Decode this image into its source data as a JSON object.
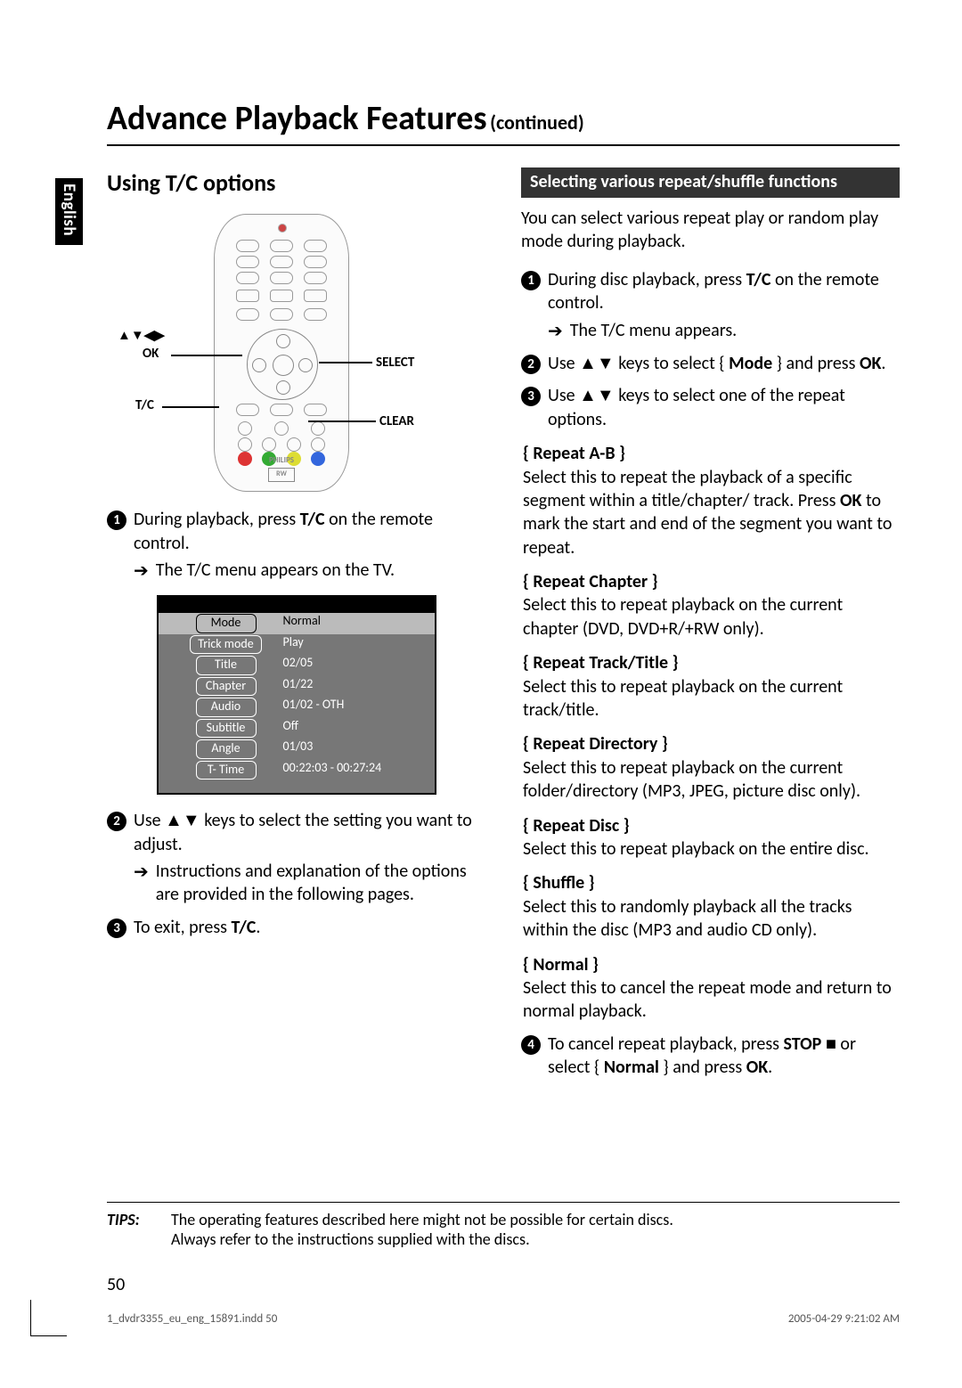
{
  "language_tab": "English",
  "title": "Advance Playback Features",
  "title_continued": "(continued)",
  "left": {
    "section_heading": "Using T/C options",
    "remote_labels": {
      "arrows": "▲▼◀▶",
      "ok": "OK",
      "tc": "T/C",
      "select": "SELECT",
      "clear": "CLEAR"
    },
    "remote_brand": "PHILIPS",
    "remote_logo": "RW",
    "step1_a": "During playback, press ",
    "step1_b": "T/C",
    "step1_c": " on the remote control.",
    "step1_note": "The T/C menu appears on the TV.",
    "osd": [
      {
        "label": "Mode",
        "value": "Normal",
        "selected": true
      },
      {
        "label": "Trick mode",
        "value": "Play",
        "selected": false
      },
      {
        "label": "Title",
        "value": "02/05",
        "selected": false
      },
      {
        "label": "Chapter",
        "value": "01/22",
        "selected": false
      },
      {
        "label": "Audio",
        "value": "01/02 - OTH",
        "selected": false
      },
      {
        "label": "Subtitle",
        "value": "Off",
        "selected": false
      },
      {
        "label": "Angle",
        "value": "01/03",
        "selected": false
      },
      {
        "label": "T- Time",
        "value": "00:22:03 - 00:27:24",
        "selected": false
      }
    ],
    "step2": "Use ▲▼ keys to select the setting you want to adjust.",
    "step2_note": "Instructions and explanation of the options are provided in the following pages.",
    "step3_a": "To exit, press ",
    "step3_b": "T/C",
    "step3_c": "."
  },
  "right": {
    "sub_heading": "Selecting various repeat/shuffle functions",
    "intro": "You can select various repeat play or random play mode during playback.",
    "step1_a": "During disc playback, press ",
    "step1_b": "T/C",
    "step1_c": " on the remote control.",
    "step1_note": "The T/C menu appears.",
    "step2_a": "Use ▲▼ keys to select { ",
    "step2_b": "Mode",
    "step2_c": " } and press ",
    "step2_d": "OK",
    "step2_e": ".",
    "step3": "Use ▲▼ keys to select one of the repeat options.",
    "opts": [
      {
        "head": "{ Repeat A-B }",
        "body_a": "Select this to repeat the playback of a specific segment within a title/chapter/ track. Press ",
        "body_b": "OK",
        "body_c": " to mark the start and end of the segment you want to repeat."
      },
      {
        "head": "{ Repeat Chapter }",
        "body_a": "Select this to repeat playback on the current chapter (DVD, DVD+R/+RW only).",
        "body_b": "",
        "body_c": ""
      },
      {
        "head": "{ Repeat Track/Title }",
        "body_a": "Select this to repeat playback on the current track/title.",
        "body_b": "",
        "body_c": ""
      },
      {
        "head": "{ Repeat Directory }",
        "body_a": "Select this to repeat playback on the current folder/directory (MP3, JPEG, picture disc only).",
        "body_b": "",
        "body_c": ""
      },
      {
        "head": "{ Repeat Disc }",
        "body_a": "Select this to repeat playback on the entire disc.",
        "body_b": "",
        "body_c": ""
      },
      {
        "head": "{ Shuffle }",
        "body_a": "Select this to randomly playback all the tracks within the disc (MP3 and audio CD only).",
        "body_b": "",
        "body_c": ""
      },
      {
        "head": "{ Normal }",
        "body_a": "Select this to cancel the repeat mode and return to normal playback.",
        "body_b": "",
        "body_c": ""
      }
    ],
    "step4_a": "To cancel repeat playback, press ",
    "step4_b": "STOP",
    "step4_c": " ■ or select { ",
    "step4_d": "Normal",
    "step4_e": " } and press ",
    "step4_f": "OK",
    "step4_g": "."
  },
  "tips": {
    "label": "TIPS:",
    "line1": "The operating features described here might not be possible for certain discs.",
    "line2": "Always refer to the instructions supplied with the discs."
  },
  "page_number": "50",
  "footer_left": "1_dvdr3355_eu_eng_15891.indd   50",
  "footer_right": "2005-04-29   9:21:02 AM"
}
